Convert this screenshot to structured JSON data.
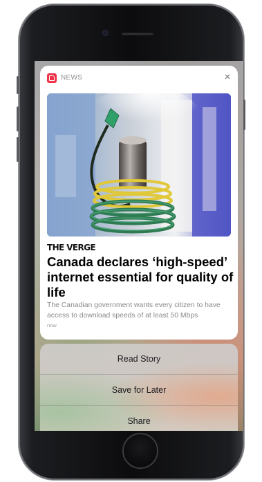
{
  "notification": {
    "app_name": "NEWS",
    "app_icon": "news-app-icon",
    "close_label": "×",
    "publisher": "THE VERGE",
    "headline": "Canada declares ‘high-speed’ internet essential for quality of life",
    "summary": "The Canadian government wants every citizen to have access to download speeds of at least 50 Mbps",
    "timestamp": "now"
  },
  "actions": [
    {
      "label": "Read Story"
    },
    {
      "label": "Save for Later"
    },
    {
      "label": "Share"
    }
  ],
  "colors": {
    "app_icon": "#f0334b",
    "card_background": "#ffffff",
    "headline_text": "#000000",
    "summary_text": "#8a8a8f"
  }
}
